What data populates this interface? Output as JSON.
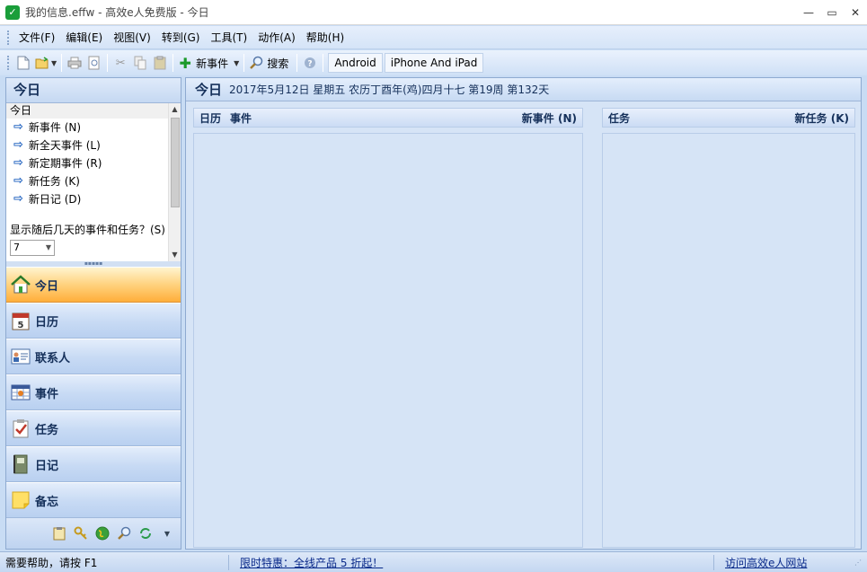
{
  "window": {
    "title": "我的信息.effw - 高效e人免费版 - 今日",
    "app_icon": "✓",
    "min": "—",
    "max": "▭",
    "close": "✕"
  },
  "menu": [
    "文件(F)",
    "编辑(E)",
    "视图(V)",
    "转到(G)",
    "工具(T)",
    "动作(A)",
    "帮助(H)"
  ],
  "toolbar": {
    "new_event": "新事件",
    "search": "搜索",
    "tabs": [
      "Android",
      "iPhone And iPad"
    ]
  },
  "left": {
    "header": "今日",
    "list_title": "今日",
    "actions": [
      "新事件 (N)",
      "新全天事件 (L)",
      "新定期事件 (R)",
      "新任务 (K)",
      "新日记 (D)"
    ],
    "days_label": "显示随后几天的事件和任务？(S)",
    "days_value": "7",
    "nav": [
      "今日",
      "日历",
      "联系人",
      "事件",
      "任务",
      "日记",
      "备忘"
    ]
  },
  "content": {
    "title": "今日",
    "date": "2017年5月12日 星期五 农历丁酉年(鸡)四月十七  第19周 第132天",
    "events_col1": "日历",
    "events_col2": "事件",
    "new_event": "新事件 (N)",
    "tasks_title": "任务",
    "new_task": "新任务 (K)"
  },
  "status": {
    "help": "需要帮助，请按 F1",
    "promo": "限时特惠：全线产品 5 折起！",
    "site": "访问高效e人网站"
  }
}
